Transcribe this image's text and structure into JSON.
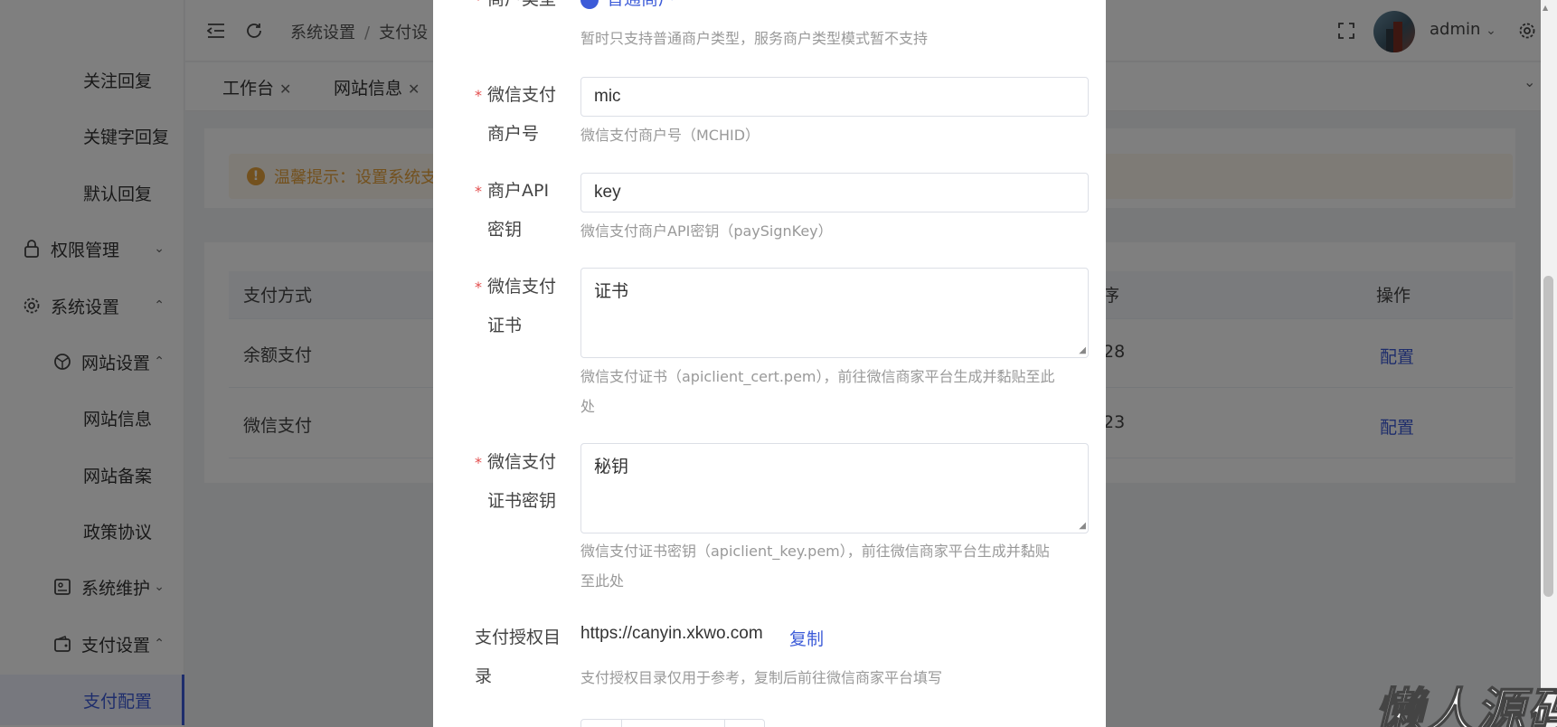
{
  "sidebar": {
    "items": [
      {
        "label": "关注回复"
      },
      {
        "label": "关键字回复"
      },
      {
        "label": "默认回复"
      },
      {
        "label": "权限管理"
      },
      {
        "label": "系统设置"
      },
      {
        "label": "网站设置"
      },
      {
        "label": "网站信息"
      },
      {
        "label": "网站备案"
      },
      {
        "label": "政策协议"
      },
      {
        "label": "系统维护"
      },
      {
        "label": "支付设置"
      },
      {
        "label": "支付配置"
      }
    ]
  },
  "header": {
    "breadcrumb_1": "系统设置",
    "breadcrumb_sep": "/",
    "breadcrumb_2": "支付设",
    "username": "admin"
  },
  "tabs": [
    {
      "label": "工作台"
    },
    {
      "label": "网站信息"
    }
  ],
  "alert": {
    "text": "温馨提示：设置系统支"
  },
  "table": {
    "headers": {
      "col1": "支付方式",
      "col3": "排序",
      "col4": "操作"
    },
    "rows": [
      {
        "name": "余额支付",
        "sort": "28",
        "action": "配置"
      },
      {
        "name": "微信支付",
        "sort": "23",
        "action": "配置"
      }
    ]
  },
  "modal": {
    "merchant_type_label": "商户类型",
    "merchant_type_value": "普通商户",
    "merchant_type_help": "暂时只支持普通商户类型，服务商户类型模式暂不支持",
    "mchid": {
      "label_1": "微信支付",
      "label_2": "商户号",
      "value": "mic",
      "help": "微信支付商户号（MCHID）"
    },
    "apikey": {
      "label_1": "商户API",
      "label_2": "密钥",
      "value": "key",
      "help": "微信支付商户API密钥（paySignKey）"
    },
    "cert": {
      "label_1": "微信支付",
      "label_2": "证书",
      "value": "证书",
      "help_1": "微信支付证书（apiclient_cert.pem），前往微信商家平台生成并黏贴至此",
      "help_2": "处"
    },
    "certkey": {
      "label_1": "微信支付",
      "label_2": "证书密钥",
      "value": "秘钥",
      "help_1": "微信支付证书密钥（apiclient_key.pem），前往微信商家平台生成并黏贴",
      "help_2": "至此处"
    },
    "authdir": {
      "label_1": "支付授权目",
      "label_2": "录",
      "url": "https://canyin.xkwo.com",
      "copy": "复制",
      "help": "支付授权目录仅用于参考，复制后前往微信商家平台填写"
    },
    "required_mark": "*"
  },
  "watermark": "懒人源码"
}
